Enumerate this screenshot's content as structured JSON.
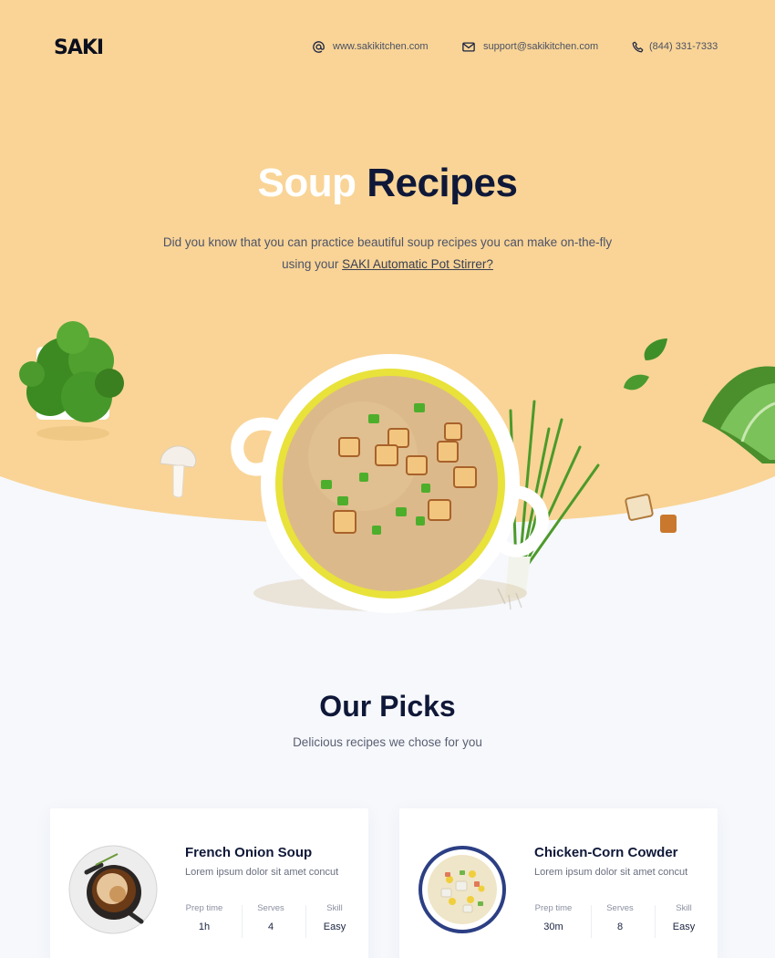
{
  "brand": {
    "logo_text": "SAKI"
  },
  "header": {
    "website": "www.sakikitchen.com",
    "email": "support@sakikitchen.com",
    "phone": "(844) 331-7333"
  },
  "hero": {
    "title_word_1": "Soup",
    "title_word_2": "Recipes",
    "subtitle_line_1": "Did you know that you can practice beautiful soup recipes you can make on-the-fly",
    "subtitle_line_2_prefix": "using your ",
    "subtitle_link": "SAKI Automatic Pot Stirrer?"
  },
  "picks": {
    "title": "Our Picks",
    "subtitle": "Delicious recipes we chose for you",
    "cards": [
      {
        "name": "French Onion Soup",
        "description": "Lorem ipsum dolor sit amet concut",
        "prep_label": "Prep time",
        "prep_value": "1h",
        "serves_label": "Serves",
        "serves_value": "4",
        "skill_label": "Skill",
        "skill_value": "Easy"
      },
      {
        "name": "Chicken-Corn Cowder",
        "description": "Lorem ipsum dolor sit amet concut",
        "prep_label": "Prep time",
        "prep_value": "30m",
        "serves_label": "Serves",
        "serves_value": "8",
        "skill_label": "Skill",
        "skill_value": "Easy"
      }
    ]
  },
  "colors": {
    "hero_yellow": "#f9d496",
    "page_bg": "#f6f8fc",
    "navy": "#0f1838",
    "soup": "#dcb98a"
  },
  "icons": [
    "at-sign-icon",
    "mail-icon",
    "phone-icon"
  ]
}
